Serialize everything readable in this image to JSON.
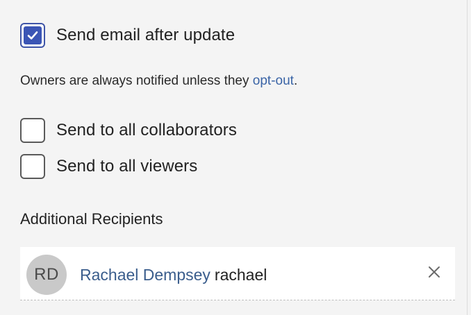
{
  "email_after_update": {
    "label": "Send email after update",
    "checked": true
  },
  "notice": {
    "text": "Owners are always notified unless they ",
    "link": "opt-out",
    "suffix": "."
  },
  "options": [
    {
      "label": "Send to all collaborators",
      "checked": false
    },
    {
      "label": "Send to all viewers",
      "checked": false
    }
  ],
  "additional_recipients": {
    "title": "Additional Recipients",
    "recipients": [
      {
        "initials": "RD",
        "name": "Rachael Dempsey",
        "username": "rachael"
      }
    ]
  },
  "colors": {
    "accent": "#3b55b5",
    "link": "#3a64a6",
    "name_link": "#3a5d8c",
    "background": "#f4f4f4"
  },
  "icons": {
    "check": "check-icon",
    "remove": "close-icon"
  }
}
